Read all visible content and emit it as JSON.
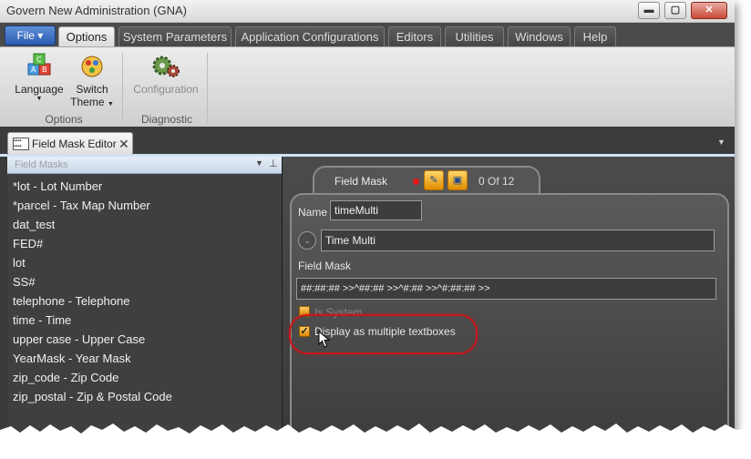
{
  "window": {
    "title": "Govern New Administration (GNA)",
    "buttons": {
      "minimize": "▬",
      "maximize": "▢",
      "close": "✕"
    }
  },
  "menubar": {
    "file_label": "File ▾",
    "tabs": [
      "Options",
      "System Parameters",
      "Application Configurations",
      "Editors",
      "Utilities",
      "Windows",
      "Help"
    ],
    "active_tab": "Options"
  },
  "ribbon": {
    "language_label": "Language",
    "switch_label_1": "Switch",
    "switch_label_2": "Theme",
    "configuration_label": "Configuration",
    "group_options": "Options",
    "group_diagnostic": "Diagnostic",
    "icons": {
      "language": "abc-blocks-icon",
      "switch_theme": "theme-palette-icon",
      "configuration": "gears-icon"
    }
  },
  "document_tab": {
    "label": "Field Mask Editor",
    "close_glyph": "✕"
  },
  "left_panel": {
    "header_label": "Field Masks",
    "items": [
      "*lot - Lot Number",
      "*parcel - Tax Map Number",
      "dat_test",
      "FED#",
      "lot",
      "SS#",
      "telephone - Telephone",
      "time - Time",
      "upper case - Upper Case",
      "YearMask - Year Mask",
      "zip_code - Zip Code",
      "zip_postal - Zip & Postal Code"
    ]
  },
  "editor": {
    "tab_title": "Field Mask",
    "record_counter": "0 Of 12",
    "name_label": "Name",
    "name_value": "timeMulti",
    "description_value": "Time Multi",
    "field_mask_label": "Field Mask",
    "field_mask_value": "##:##:## >>^##:## >>^#:## >>^#:##:## >>",
    "is_system_label": "Is System",
    "is_system_checked": false,
    "multiple_textboxes_label": "Display as multiple textboxes",
    "multiple_textboxes_checked": true
  },
  "colors": {
    "accent_orange": "#e08c00",
    "highlight_red": "#c8171b",
    "file_button_blue": "#2a5bb0"
  }
}
